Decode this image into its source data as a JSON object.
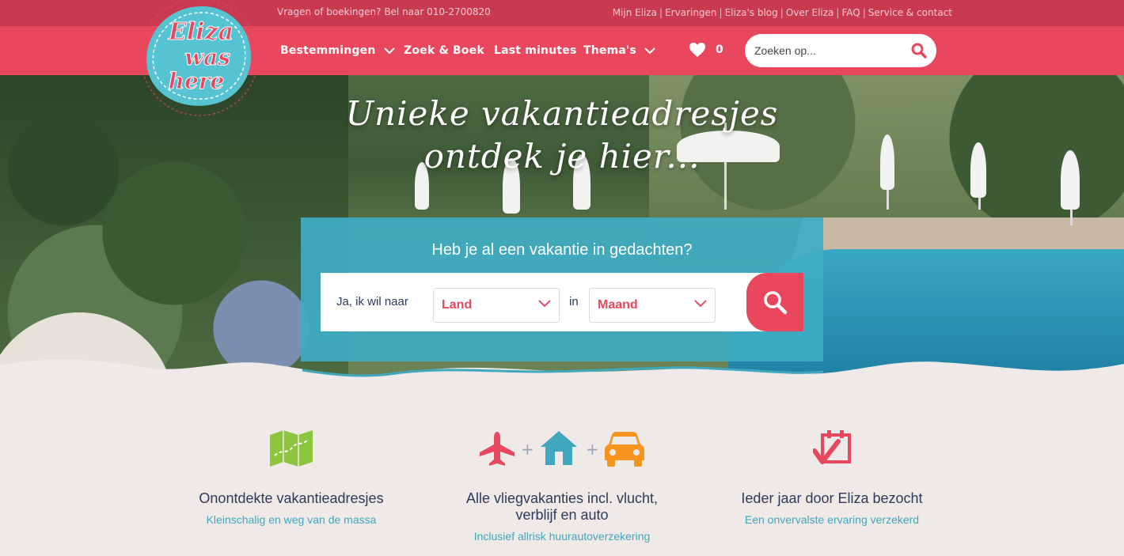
{
  "topbar": {
    "phone": "Vragen of boekingen? Bel naar 010-2700820",
    "links": [
      "Mijn Eliza",
      "Ervaringen",
      "Eliza's blog",
      "Over Eliza",
      "FAQ",
      "Service & contact"
    ]
  },
  "logo": {
    "line1": "Eliza",
    "line2": "was",
    "line3": "here"
  },
  "nav": {
    "items": [
      {
        "label": "Bestemmingen",
        "has_dropdown": true
      },
      {
        "label": "Zoek & Boek",
        "has_dropdown": false
      },
      {
        "label": "Last minutes",
        "has_dropdown": false
      },
      {
        "label": "Thema's",
        "has_dropdown": true
      }
    ],
    "favorites_count": "0",
    "search_placeholder": "Zoeken op..."
  },
  "hero": {
    "title_line1": "Unieke vakantieadresjes",
    "title_line2": "ontdek je hier..."
  },
  "booking": {
    "question": "Heb je al een vakantie in gedachten?",
    "prefix": "Ja, ik wil naar",
    "country_value": "Land",
    "in_label": "in",
    "month_value": "Maand"
  },
  "usps": [
    {
      "title": "Onontdekte vakantieadresjes",
      "subtitle": "Kleinschalig en weg van de massa"
    },
    {
      "title_line1": "Alle vliegvakanties incl. vlucht,",
      "title_line2": "verblijf en auto",
      "subtitle": "Inclusief allrisk huurautoverzekering"
    },
    {
      "title": "Ieder jaar door Eliza bezocht",
      "subtitle": "Een onvervalste ervaring verzekerd"
    }
  ],
  "colors": {
    "topbar": "#c93a50",
    "nav": "#e8475d",
    "accent_blue": "#3fa7be",
    "page_bg": "#efe9e8",
    "green_icon": "#8cc63f",
    "orange_icon": "#f7941d"
  },
  "icons": [
    "map-icon",
    "airplane-icon",
    "house-icon",
    "car-icon",
    "calendar-check-icon",
    "heart-icon",
    "search-icon"
  ]
}
